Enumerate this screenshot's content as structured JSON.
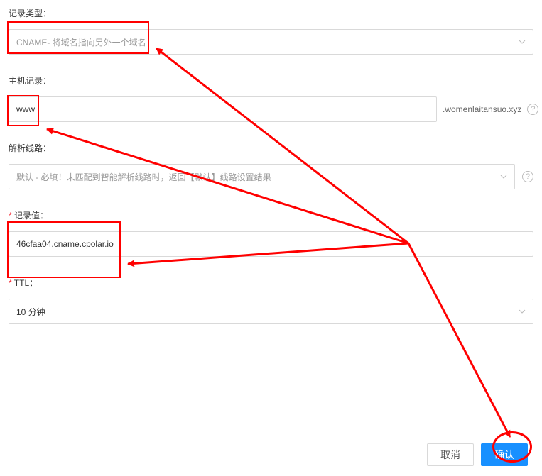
{
  "recordType": {
    "label": "记录类型：",
    "value": "CNAME- 将域名指向另外一个域名"
  },
  "hostRecord": {
    "label": "主机记录：",
    "value": "www",
    "suffix": ".womenlaitansuo.xyz"
  },
  "resolveLine": {
    "label": "解析线路：",
    "value": "默认 - 必填！未匹配到智能解析线路时，返回【默认】线路设置结果"
  },
  "recordValue": {
    "label": "记录值：",
    "value": "46cfaa04.cname.cpolar.io"
  },
  "ttl": {
    "label": "TTL：",
    "value": "10 分钟"
  },
  "buttons": {
    "cancel": "取消",
    "confirm": "确认"
  },
  "help": "?"
}
